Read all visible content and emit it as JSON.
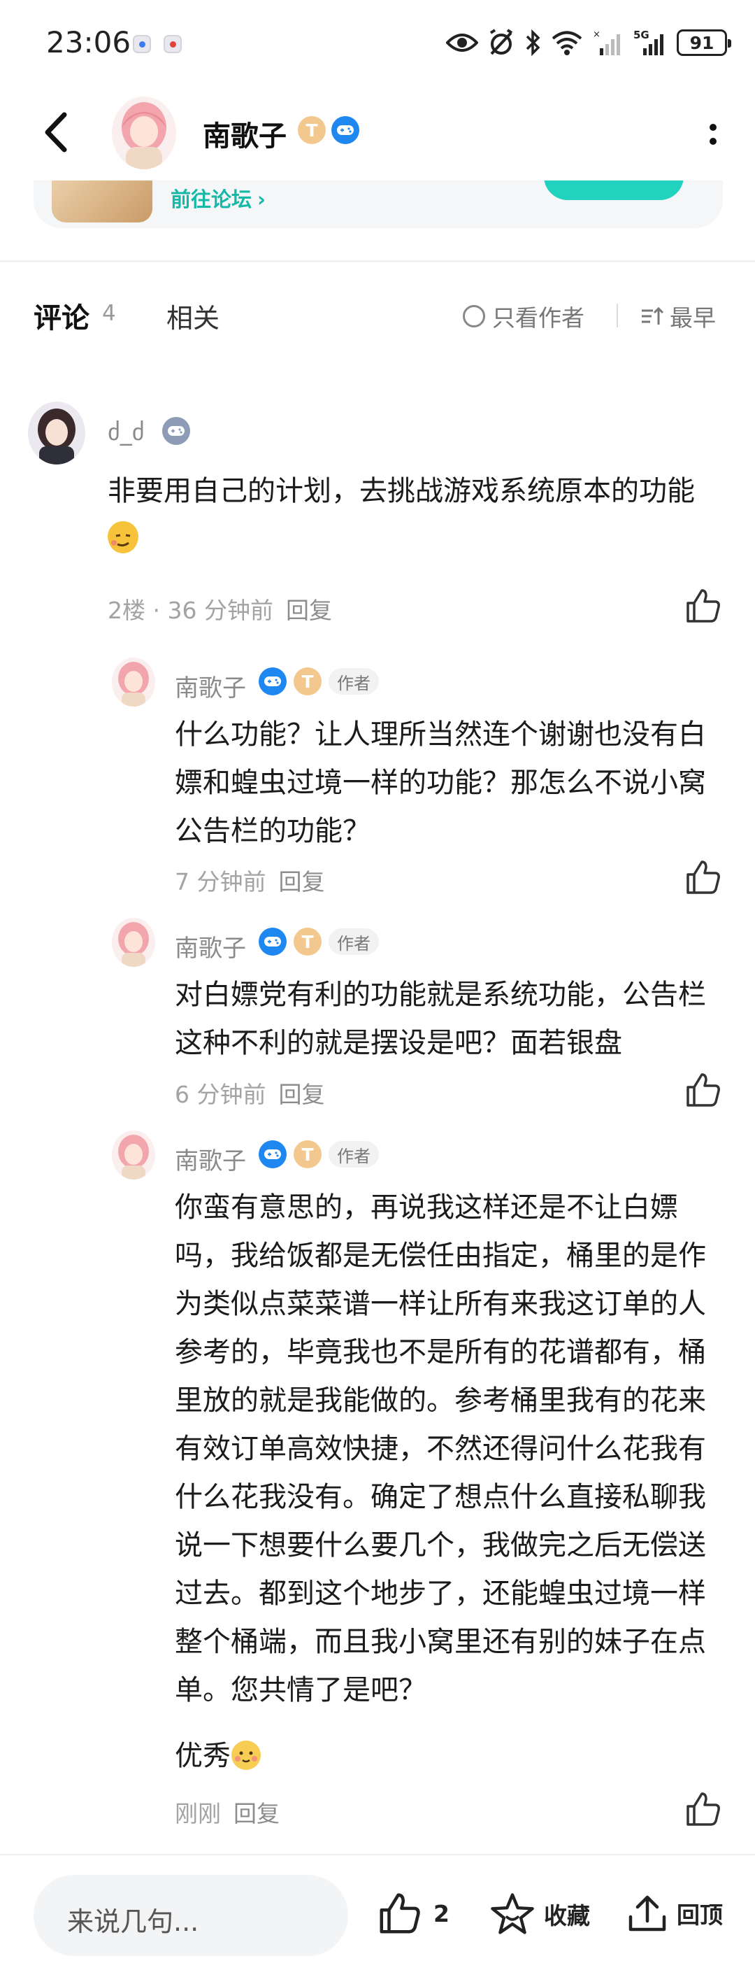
{
  "status_bar": {
    "time": "23:06",
    "battery": "91",
    "network": "5G"
  },
  "header": {
    "name": "南歌子",
    "badge_t": "T"
  },
  "forum_card": {
    "link_label": "前往论坛"
  },
  "tabs": {
    "comments_label": "评论",
    "comments_count": "4",
    "related_label": "相关",
    "only_author_label": "只看作者",
    "sort_label": "最早"
  },
  "comments": [
    {
      "author": "ძ_ძ",
      "text": "非要用自己的计划，去挑战游戏系统原本的功能",
      "floor": "2楼",
      "time": "36 分钟前",
      "reply_label": "回复"
    }
  ],
  "replies": [
    {
      "author": "南歌子",
      "author_tag": "作者",
      "text": "什么功能？让人理所当然连个谢谢也没有白嫖和蝗虫过境一样的功能？那怎么不说小窝公告栏的功能？",
      "time": "7 分钟前",
      "reply_label": "回复"
    },
    {
      "author": "南歌子",
      "author_tag": "作者",
      "text": "对白嫖党有利的功能就是系统功能，公告栏这种不利的就是摆设是吧？面若银盘",
      "time": "6 分钟前",
      "reply_label": "回复"
    },
    {
      "author": "南歌子",
      "author_tag": "作者",
      "text": "你蛮有意思的，再说我这样还是不让白嫖吗，我给饭都是无偿任由指定，桶里的是作为类似点菜菜谱一样让所有来我这订单的人参考的，毕竟我也不是所有的花谱都有，桶里放的就是我能做的。参考桶里我有的花来有效订单高效快捷，不然还得问什么花我有什么花我没有。确定了想点什么直接私聊我说一下想要什么要几个，我做完之后无偿送过去。都到这个地步了，还能蝗虫过境一样整个桶端，而且我小窝里还有别的妹子在点单。您共情了是吧？",
      "extra": "优秀",
      "time": "刚刚",
      "reply_label": "回复"
    }
  ],
  "bottom_bar": {
    "input_placeholder": "来说几句...",
    "like_count": "2",
    "favorite_label": "收藏",
    "top_label": "回顶"
  },
  "colors": {
    "accent": "#24d1c0",
    "game_badge": "#1e88f0",
    "t_badge": "#f2c88f"
  }
}
